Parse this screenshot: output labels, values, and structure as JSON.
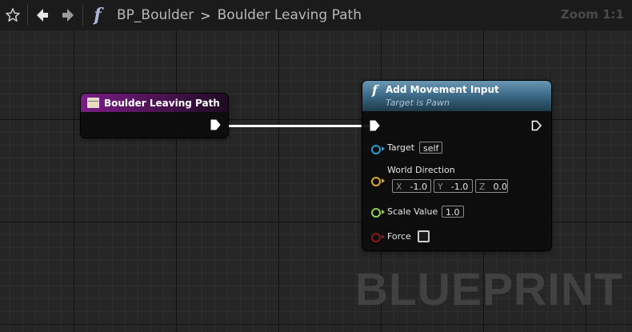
{
  "toolbar": {
    "icons": [
      "star-icon",
      "back-arrow-icon",
      "forward-arrow-icon",
      "function-icon"
    ],
    "function_symbol": "f",
    "breadcrumb": [
      "BP_Boulder",
      "Boulder Leaving Path"
    ],
    "breadcrumb_separator": ">",
    "zoom_label": "Zoom 1:1"
  },
  "event_node": {
    "title": "Boulder Leaving Path",
    "header_color": "#7b1e86"
  },
  "function_node": {
    "symbol": "f",
    "title": "Add Movement Input",
    "subtitle": "Target is Pawn",
    "header_color": "#4a7a98",
    "pins": {
      "target": {
        "label": "Target",
        "value": "self",
        "color": "#2a9bd8"
      },
      "world_direction": {
        "label": "World Direction",
        "color": "#e0a82e",
        "x_label": "X",
        "x": "-1.0",
        "y_label": "Y",
        "y": "-1.0",
        "z_label": "Z",
        "z": "0.0"
      },
      "scale_value": {
        "label": "Scale Value",
        "value": "1.0",
        "color": "#8fd14f"
      },
      "force": {
        "label": "Force",
        "checked": false,
        "color": "#8a1a1a"
      }
    }
  },
  "watermark": "BLUEPRINT"
}
